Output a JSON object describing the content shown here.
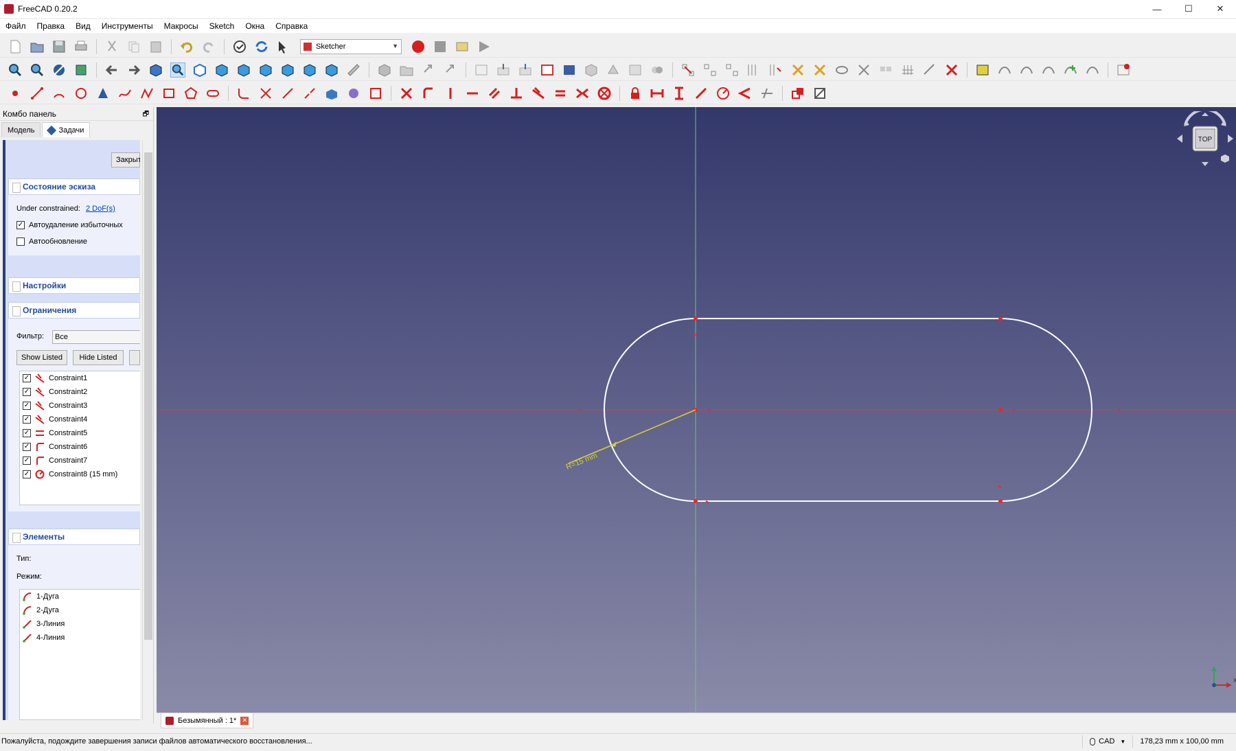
{
  "window": {
    "title": "FreeCAD 0.20.2",
    "minimize_glyph": "—",
    "maximize_glyph": "☐",
    "close_glyph": "✕"
  },
  "menu": [
    "Файл",
    "Правка",
    "Вид",
    "Инструменты",
    "Макросы",
    "Sketch",
    "Окна",
    "Справка"
  ],
  "workbench": {
    "selected": "Sketcher",
    "arrow_glyph": "▼"
  },
  "combo": {
    "title": "Комбо панель",
    "pin_glyph": "🗗",
    "tabs": [
      "Модель",
      "Задачи"
    ],
    "close_button": "Закрыть",
    "sketch_state": {
      "title": "Состояние эскиза",
      "under_label": "Under constrained:",
      "dof_link": "2 DoF(s)",
      "auto_remove": "Автоудаление избыточных",
      "auto_update": "Автообновление",
      "auto_remove_mark": "✓"
    },
    "settings": {
      "title": "Настройки"
    },
    "constraints": {
      "title": "Ограничения",
      "filter_label": "Фильтр:",
      "filter_value": "Все",
      "show_listed": "Show Listed",
      "hide_listed": "Hide Listed",
      "check_mark": "✓",
      "items": [
        {
          "name": "Constraint1",
          "icon": "tangent-constraint-icon"
        },
        {
          "name": "Constraint2",
          "icon": "tangent-constraint-icon"
        },
        {
          "name": "Constraint3",
          "icon": "tangent-constraint-icon"
        },
        {
          "name": "Constraint4",
          "icon": "tangent-constraint-icon"
        },
        {
          "name": "Constraint5",
          "icon": "equal-constraint-icon"
        },
        {
          "name": "Constraint6",
          "icon": "coincident-constraint-icon"
        },
        {
          "name": "Constraint7",
          "icon": "coincident-constraint-icon"
        },
        {
          "name": "Constraint8 (15 mm)",
          "icon": "radius-constraint-icon"
        }
      ]
    },
    "elements": {
      "title": "Элементы",
      "type_label": "Тип:",
      "mode_label": "Режим:",
      "items": [
        {
          "name": "1-Дуга",
          "icon": "arc-element-icon"
        },
        {
          "name": "2-Дуга",
          "icon": "arc-element-icon"
        },
        {
          "name": "3-Линия",
          "icon": "line-element-icon"
        },
        {
          "name": "4-Линия",
          "icon": "line-element-icon"
        }
      ]
    }
  },
  "viewport": {
    "navcube_face": "TOP",
    "dimension_label": "R=15 mm",
    "axis_x": "X",
    "colors": {
      "x_axis": "#d44040",
      "y_axis": "#5fd06a",
      "geometry": "#ffffff",
      "points": "#ff2020",
      "dimension": "#d8d030"
    }
  },
  "doc_tab": {
    "label": "Безымянный : 1*",
    "close_glyph": "✕"
  },
  "status": {
    "message": "Пожалуйста, подождите завершения записи файлов автоматического восстановления...",
    "nav_style": "CAD",
    "nav_arrow": "▼",
    "dimensions": "178,23 mm x 100,00 mm"
  }
}
